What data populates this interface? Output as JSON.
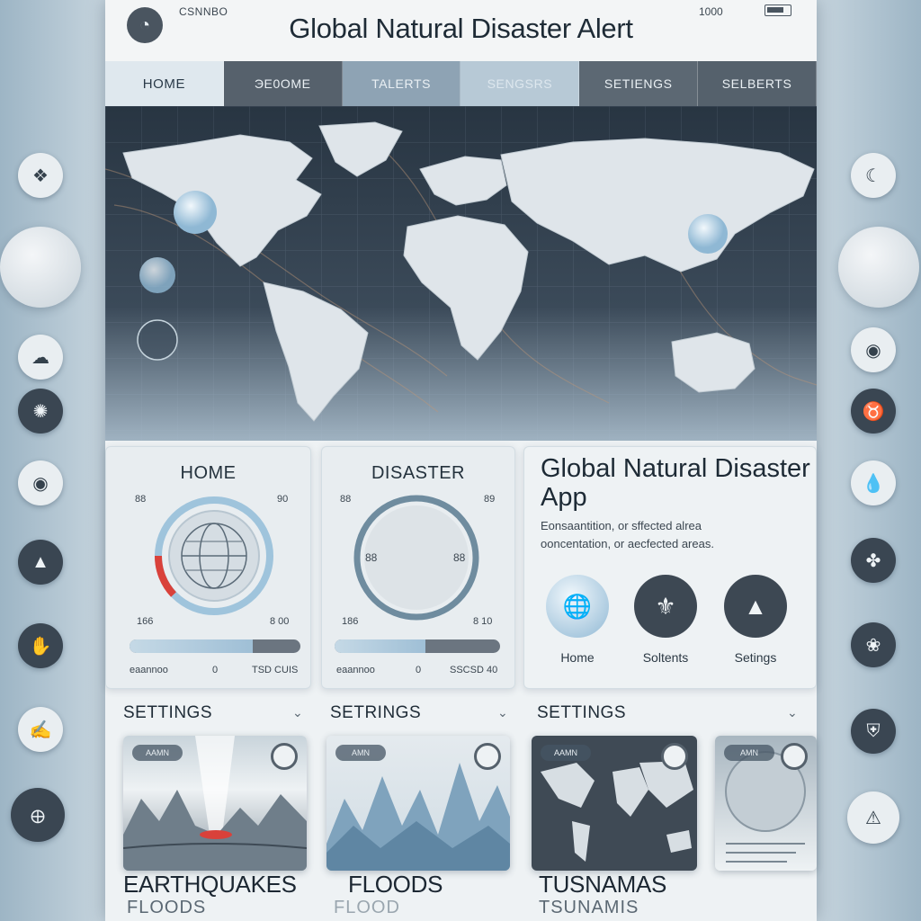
{
  "app": {
    "title": "Global Natural Disaster Alert",
    "carrier": "CSNNBO",
    "time": "1000"
  },
  "tabs": [
    {
      "label": "HOME"
    },
    {
      "label": "ЭE0OME"
    },
    {
      "label": "TALERTS"
    },
    {
      "label": "SENGSRS"
    },
    {
      "label": "SETIENGS"
    },
    {
      "label": "SELBERTS"
    }
  ],
  "cards": {
    "home": {
      "title": "HOME",
      "top_left": "88",
      "top_right": "90",
      "bottom_left": "166",
      "bottom_right": "8 00",
      "foot_left": "eaannoo",
      "foot_mid": "0",
      "foot_right": "TSD CUIS",
      "progress": 0.72
    },
    "disaster": {
      "title": "DISASTER",
      "top_left": "88",
      "top_right": "89",
      "inner_left": "88",
      "inner_right": "88",
      "bottom_left": "186",
      "bottom_right": "8 10",
      "foot_left": "eaannoo",
      "foot_mid": "0",
      "foot_right": "SSCSD 40",
      "progress": 0.55
    },
    "info": {
      "title": "Global Natural Disaster App",
      "line1": "Eonsaantition, or sffected alrea",
      "line2": "ooncentation, or aecfected areas.",
      "buttons": [
        {
          "label": "Home",
          "icon": "globe-icon"
        },
        {
          "label": "Soltents",
          "icon": "fleur-icon"
        },
        {
          "label": "Setings",
          "icon": "drop-icon"
        }
      ]
    }
  },
  "sections": [
    {
      "label": "SETTINGS"
    },
    {
      "label": "SETRINGS"
    },
    {
      "label": "SETTINGS"
    }
  ],
  "bottom_cards": [
    {
      "title": "EARTHQUAKES",
      "subtitle": "FLOODS",
      "pill": "AAMN"
    },
    {
      "title": "FLOODS",
      "subtitle": "FLOOD",
      "pill": "AMN"
    },
    {
      "title": "TUSNAMAS",
      "subtitle": "TSUNAMIS",
      "pill": "AAMN"
    },
    {
      "title": "",
      "subtitle": "",
      "pill": "AMN"
    }
  ],
  "colors": {
    "accent": "#8fb8d4",
    "dark": "#3d4853",
    "alert_red": "#d9413a"
  }
}
